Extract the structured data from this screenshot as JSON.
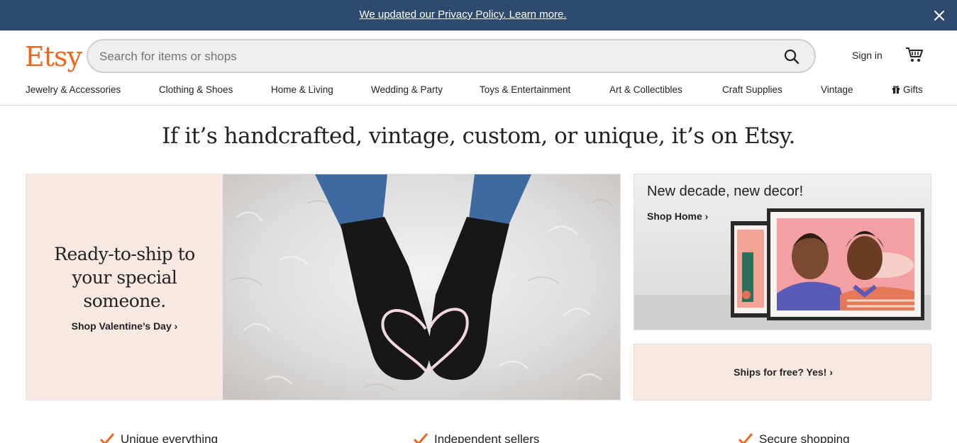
{
  "banner": {
    "text": "We updated our Privacy Policy. Learn more.",
    "close_icon": "close-icon"
  },
  "header": {
    "logo": "Etsy",
    "search": {
      "placeholder": "Search for items or shops",
      "value": "",
      "icon": "search-icon"
    },
    "sign_in": "Sign in",
    "cart_icon": "cart-icon"
  },
  "categories": [
    "Jewelry & Accessories",
    "Clothing & Shoes",
    "Home & Living",
    "Wedding & Party",
    "Toys & Entertainment",
    "Art & Collectibles",
    "Craft Supplies",
    "Vintage",
    "Gifts"
  ],
  "hero": {
    "tagline": "If it’s handcrafted, vintage, custom, or unique, it’s on Etsy.",
    "title": "Ready-to-ship to your special someone.",
    "cta": "Shop Valentine’s Day ›"
  },
  "promo": {
    "title": "New decade, new decor!",
    "link": "Shop Home ›"
  },
  "ships": {
    "label": "Ships for free? Yes! ›"
  },
  "features": [
    "Unique everything",
    "Independent sellers",
    "Secure shopping"
  ],
  "colors": {
    "banner": "#2e4a6f",
    "brand": "#f1641e",
    "blush": "#f8e8e2"
  }
}
